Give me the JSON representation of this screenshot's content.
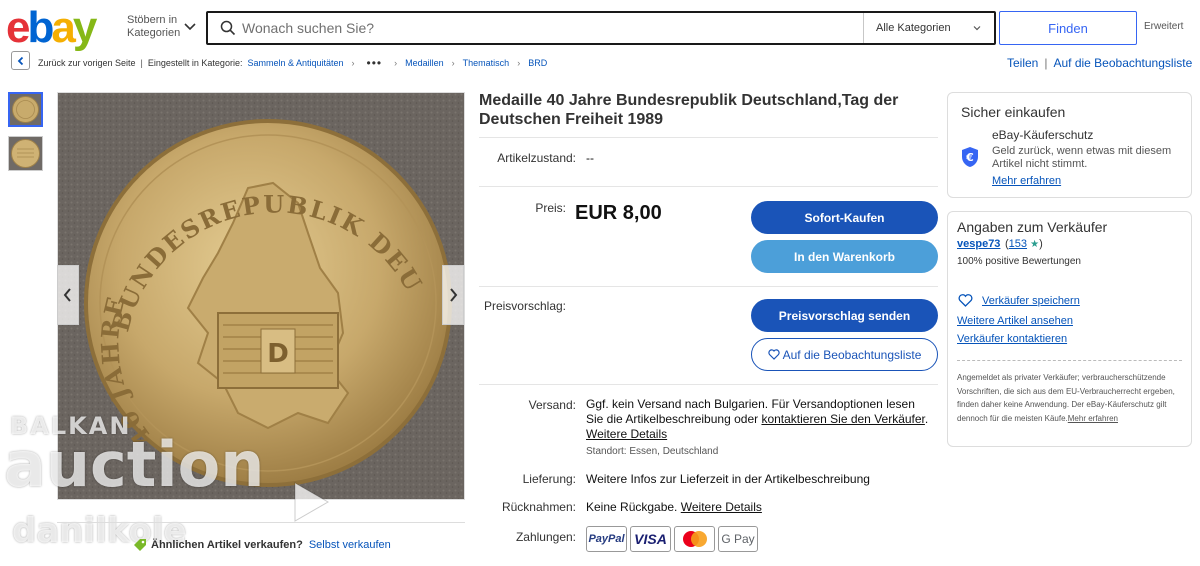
{
  "header": {
    "logo": [
      "e",
      "b",
      "a",
      "y"
    ],
    "browse_line1": "Stöbern in",
    "browse_line2": "Kategorien",
    "search_placeholder": "Wonach suchen Sie?",
    "category": "Alle Kategorien",
    "find_label": "Finden",
    "advanced_label": "Erweitert"
  },
  "breadcrumb": {
    "back_label": "Zurück zur vorigen Seite",
    "listed_in": "Eingestellt in Kategorie:",
    "items": [
      "Sammeln & Antiquitäten",
      "Medaillen",
      "Thematisch",
      "BRD"
    ],
    "ellipsis": "•••",
    "separator": "|"
  },
  "actions": {
    "share": "Teilen",
    "watchlist": "Auf die Beobachtungsliste"
  },
  "image": {
    "coin_top_text": "BUNDESREPUBLIK DEUTSCHLAND",
    "coin_left_text": "40 JAHRE",
    "coin_emblem": "D",
    "watermark_line1": "BALKAN",
    "watermark_line2": "auction",
    "watermark_line3": "danilkole"
  },
  "sell_similar": {
    "question": "Ähnlichen Artikel verkaufen?",
    "link": "Selbst verkaufen"
  },
  "listing": {
    "title": "Medaille 40 Jahre Bundesrepublik Deutschland,Tag der Deutschen Freiheit 1989",
    "condition_label": "Artikelzustand:",
    "condition_value": "--",
    "price_label": "Preis:",
    "price": "EUR 8,00",
    "buy_now": "Sofort-Kaufen",
    "add_cart": "In den Warenkorb",
    "offer_label": "Preisvorschlag:",
    "offer_btn": "Preisvorschlag senden",
    "watch_btn": "Auf die Beobachtungsliste",
    "shipping_label": "Versand:",
    "shipping_text_1": "Ggf. kein Versand nach Bulgarien. Für Versandoptionen lesen Sie die Artikelbeschreibung oder ",
    "shipping_link_contact": "kontaktieren Sie den Verkäufer",
    "shipping_text_2": ". ",
    "shipping_link_details": "Weitere Details",
    "location": "Standort: Essen, Deutschland",
    "delivery_label": "Lieferung:",
    "delivery_value": "Weitere Infos zur Lieferzeit in der Artikelbeschreibung",
    "returns_label": "Rücknahmen:",
    "returns_value": "Keine Rückgabe.",
    "returns_link": "Weitere Details",
    "payments_label": "Zahlungen:",
    "payments": [
      "PayPal",
      "VISA",
      "Mastercard",
      "G Pay"
    ]
  },
  "secure": {
    "title": "Sicher einkaufen",
    "protection_title": "eBay-Käuferschutz",
    "protection_desc": "Geld zurück, wenn etwas mit diesem Artikel nicht stimmt.",
    "learn_more": "Mehr erfahren"
  },
  "seller": {
    "title": "Angaben zum Verkäufer",
    "name": "vespe73",
    "score_open": "(",
    "score": "153",
    "score_close": ")",
    "positive": "100% positive Bewertungen",
    "save_seller": "Verkäufer speichern",
    "more_items": "Weitere Artikel ansehen",
    "contact": "Verkäufer kontaktieren",
    "note": "Angemeldet als privater Verkäufer; verbraucherschützende Vorschriften, die sich aus dem EU-Verbraucherrecht ergeben, finden daher keine Anwendung. Der eBay-Käuferschutz gilt dennoch für die meisten Käufe.",
    "note_link": "Mehr erfahren"
  }
}
